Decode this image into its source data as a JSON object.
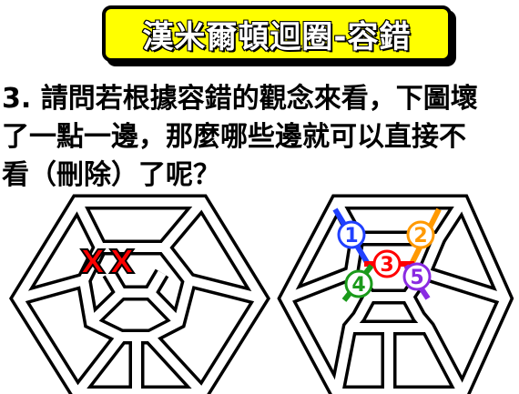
{
  "title": "漢米爾頓迴圈-容錯",
  "question": {
    "line1": "3. 請問若根據容錯的觀念來看，下圖壞",
    "line2": "了一點一邊，那麼哪些邊就可以直接不",
    "line3": "看（刪除）了呢？"
  },
  "left_figure": {
    "marks": [
      "X",
      "X"
    ],
    "mark_color": "#ff0000"
  },
  "right_figure": {
    "edge_labels": [
      {
        "label": "1",
        "color": "#2040ff"
      },
      {
        "label": "2",
        "color": "#ff9900"
      },
      {
        "label": "3",
        "color": "#ff0000"
      },
      {
        "label": "4",
        "color": "#1a9a1a"
      },
      {
        "label": "5",
        "color": "#8a2be2"
      }
    ]
  }
}
